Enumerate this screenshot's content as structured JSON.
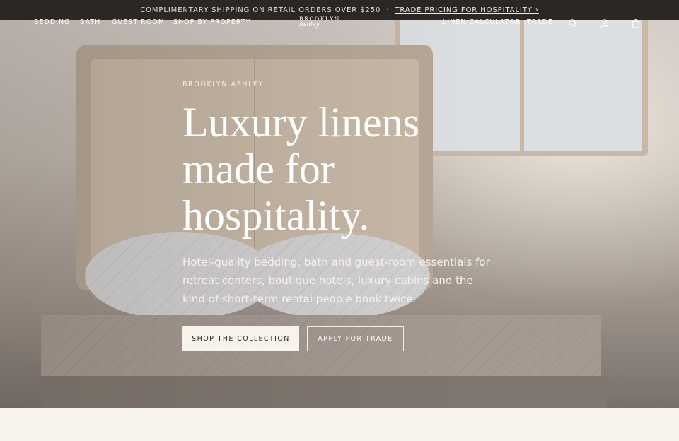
{
  "announcement": {
    "shipping_text": "COMPLIMENTARY SHIPPING ON RETAIL ORDERS OVER $250",
    "separator": "·",
    "trade_link": "TRADE PRICING FOR HOSPITALITY ›"
  },
  "nav": {
    "left_items": [
      "BEDDING",
      "BATH",
      "GUEST ROOM",
      "SHOP BY PROPERTY"
    ],
    "logo_top": "BROOKLYN",
    "logo_bottom": "Ashley",
    "right_items": [
      "LINEN CALCULATOR",
      "TRADE"
    ],
    "icons": [
      "search-icon",
      "account-icon",
      "bag-icon"
    ]
  },
  "hero": {
    "eyebrow": "BROOKLYN ASHLEY",
    "headline": "Luxury linens made for hospitality.",
    "subcopy": "Hotel-quality bedding, bath and guest-room essentials for retreat centers, boutique hotels, luxury cabins and the kind of short-term rental people book twice.",
    "primary_cta": "SHOP THE COLLECTION",
    "secondary_cta": "APPLY FOR TRADE"
  },
  "colors": {
    "announcement_bg": "#2b2724",
    "page_bg": "#f8f2ec",
    "primary_button_bg": "#f8f2ec",
    "text_on_hero": "#ffffff"
  }
}
